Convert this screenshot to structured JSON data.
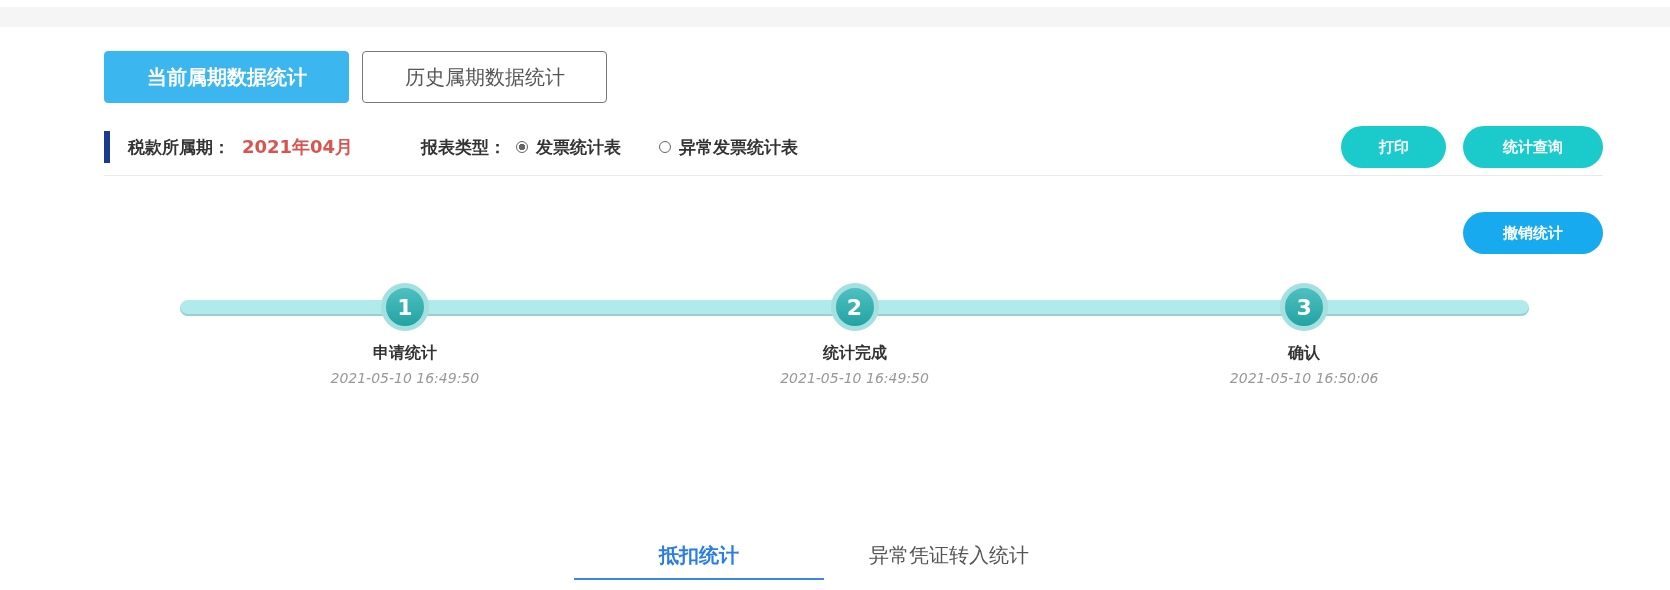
{
  "period_tabs": [
    {
      "label": "当前属期数据统计",
      "selected": true
    },
    {
      "label": "历史属期数据统计",
      "selected": false
    }
  ],
  "filter": {
    "period_label": "税款所属期：",
    "period_value": "2021年04月",
    "type_label": "报表类型：",
    "options": [
      {
        "label": "发票统计表",
        "selected": true
      },
      {
        "label": "异常发票统计表",
        "selected": false
      }
    ]
  },
  "actions": [
    "打印",
    "统计查询"
  ],
  "cancel_button": "撤销统计",
  "steps": [
    {
      "number": "1",
      "title": "申请统计",
      "time": "2021-05-10 16:49:50"
    },
    {
      "number": "2",
      "title": "统计完成",
      "time": "2021-05-10 16:49:50"
    },
    {
      "number": "3",
      "title": "确认",
      "time": "2021-05-10 16:50:06"
    }
  ],
  "bottom_tabs": [
    {
      "label": "抵扣统计",
      "selected": true
    },
    {
      "label": "异常凭证转入统计",
      "selected": false
    }
  ]
}
